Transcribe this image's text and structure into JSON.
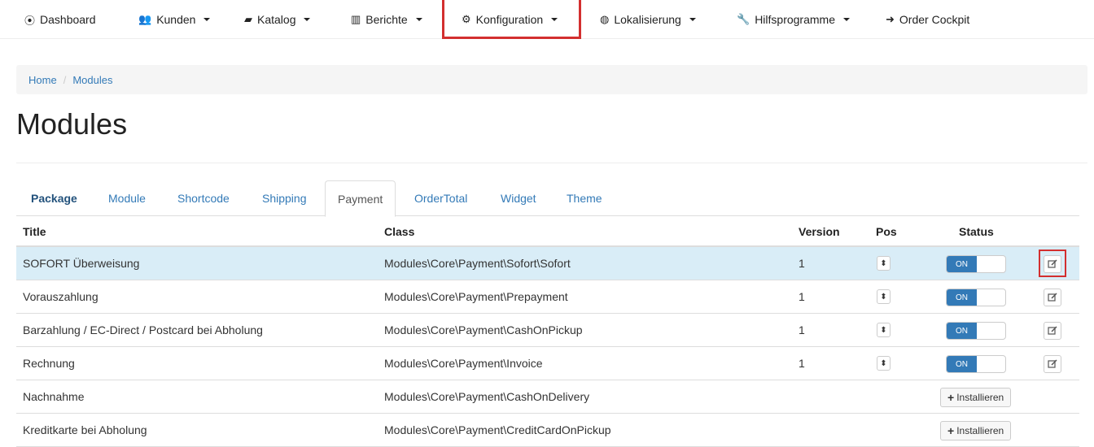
{
  "nav": {
    "items": [
      {
        "icon": "tachometer-icon",
        "glyph": "⦿",
        "label": "Dashboard",
        "dropdown": false
      },
      {
        "icon": "users-icon",
        "glyph": "👥",
        "label": "Kunden",
        "dropdown": true
      },
      {
        "icon": "book-icon",
        "glyph": "▰",
        "label": "Katalog",
        "dropdown": true
      },
      {
        "icon": "bar-chart-icon",
        "glyph": "▥",
        "label": "Berichte",
        "dropdown": true
      },
      {
        "icon": "cogs-icon",
        "glyph": "⚙",
        "label": "Konfiguration",
        "dropdown": true
      },
      {
        "icon": "globe-icon",
        "glyph": "◍",
        "label": "Lokalisierung",
        "dropdown": true
      },
      {
        "icon": "wrench-icon",
        "glyph": "🔧",
        "label": "Hilfsprogramme",
        "dropdown": true
      },
      {
        "icon": "sign-in-icon",
        "glyph": "➜",
        "label": "Order Cockpit",
        "dropdown": false
      }
    ],
    "highlighted": "Konfiguration"
  },
  "breadcrumb": {
    "home": "Home",
    "separator": "/",
    "current": "Modules"
  },
  "page": {
    "title": "Modules"
  },
  "tabs": [
    {
      "label": "Package",
      "state": "bold"
    },
    {
      "label": "Module",
      "state": "normal"
    },
    {
      "label": "Shortcode",
      "state": "normal"
    },
    {
      "label": "Shipping",
      "state": "normal"
    },
    {
      "label": "Payment",
      "state": "active"
    },
    {
      "label": "OrderTotal",
      "state": "normal"
    },
    {
      "label": "Widget",
      "state": "normal"
    },
    {
      "label": "Theme",
      "state": "normal"
    }
  ],
  "table": {
    "headers": {
      "title": "Title",
      "class": "Class",
      "version": "Version",
      "pos": "Pos",
      "status": "Status"
    },
    "rows": [
      {
        "title": "SOFORT Überweisung",
        "class": "Modules\\Core\\Payment\\Sofort\\Sofort",
        "version": "1",
        "installed": true,
        "status": "ON",
        "highlighted": true
      },
      {
        "title": "Vorauszahlung",
        "class": "Modules\\Core\\Payment\\Prepayment",
        "version": "1",
        "installed": true,
        "status": "ON",
        "highlighted": false
      },
      {
        "title": "Barzahlung / EC-Direct / Postcard bei Abholung",
        "class": "Modules\\Core\\Payment\\CashOnPickup",
        "version": "1",
        "installed": true,
        "status": "ON",
        "highlighted": false
      },
      {
        "title": "Rechnung",
        "class": "Modules\\Core\\Payment\\Invoice",
        "version": "1",
        "installed": true,
        "status": "ON",
        "highlighted": false
      },
      {
        "title": "Nachnahme",
        "class": "Modules\\Core\\Payment\\CashOnDelivery",
        "version": "",
        "installed": false,
        "install_label": "Installieren",
        "highlighted": false
      },
      {
        "title": "Kreditkarte bei Abholung",
        "class": "Modules\\Core\\Payment\\CreditCardOnPickup",
        "version": "",
        "installed": false,
        "install_label": "Installieren",
        "highlighted": false
      }
    ]
  },
  "colors": {
    "link": "#337ab7",
    "highlight_box": "#d32f2f",
    "row_highlight": "#d9edf7",
    "switch_on": "#337ab7"
  }
}
